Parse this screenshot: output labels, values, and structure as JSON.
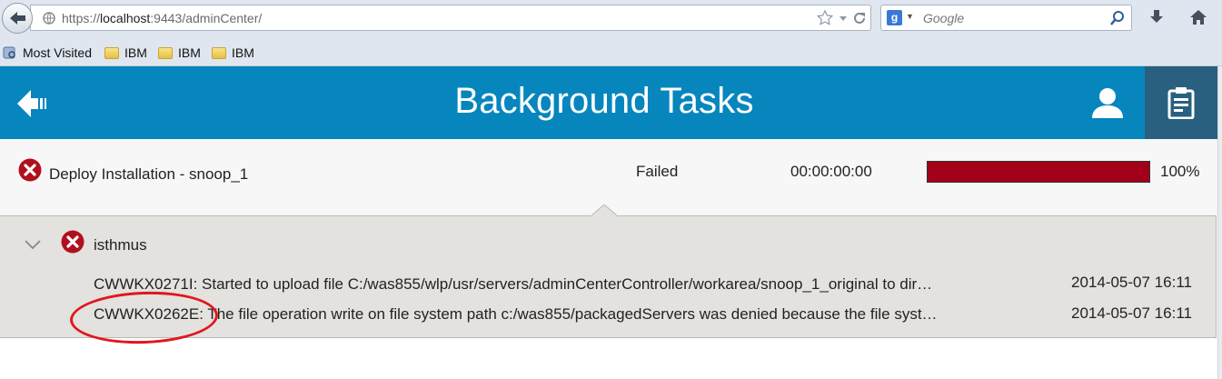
{
  "browser": {
    "url_prefix": "https://",
    "url_host": "localhost",
    "url_rest": ":9443/adminCenter/",
    "search_placeholder": "Google",
    "search_engine_letter": "g",
    "bookmarks": [
      {
        "label": "Most Visited",
        "icon": "bookmarks-icon"
      },
      {
        "label": "IBM",
        "icon": "folder-icon"
      },
      {
        "label": "IBM",
        "icon": "folder-icon"
      },
      {
        "label": "IBM",
        "icon": "folder-icon"
      }
    ]
  },
  "header": {
    "title": "Background Tasks",
    "accent_color": "#0686bd",
    "selected_color": "#29607f"
  },
  "task": {
    "name": "Deploy Installation - snoop_1",
    "status": "Failed",
    "elapsed": "00:00:00:00",
    "progress_fraction": 1.0,
    "progress_label": "100%",
    "progress_color": "#a30019"
  },
  "details": {
    "server": "isthmus",
    "messages": [
      {
        "text": "CWWKX0271I: Started to upload file C:/was855/wlp/usr/servers/adminCenterController/workarea/snoop_1_original to dir…",
        "time": "2014-05-07 16:11"
      },
      {
        "text": "CWWKX0262E: The file operation write on file system path c:/was855/packagedServers was denied because the file syst…",
        "time": "2014-05-07 16:11"
      }
    ]
  }
}
